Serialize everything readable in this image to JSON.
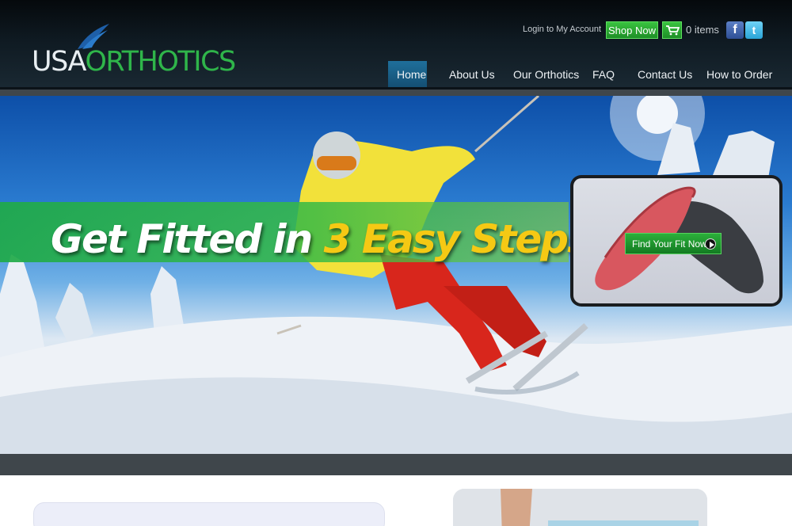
{
  "header": {
    "logo": {
      "part1": "USA",
      "part2": "ORTHOTICS"
    },
    "login_link": "Login to My Account",
    "shop_button": "Shop Now",
    "cart_count": "0 items",
    "social": {
      "facebook": "f",
      "twitter": "t"
    }
  },
  "nav": {
    "items": [
      {
        "label": "Home",
        "active": true
      },
      {
        "label": "About Us",
        "active": false
      },
      {
        "label": "Our Orthotics",
        "active": false
      },
      {
        "label": "FAQ",
        "active": false
      },
      {
        "label": "Contact Us",
        "active": false
      },
      {
        "label": "How to Order",
        "active": false
      }
    ]
  },
  "hero": {
    "headline_part1": "Get Fitted in ",
    "headline_part2": "3 Easy Steps",
    "cta_button": "Find Your Fit Now"
  },
  "icons": {
    "cart": "cart-icon",
    "play": "play-icon",
    "wing": "wing-icon"
  },
  "colors": {
    "brand_green": "#2fb54a",
    "headline_yellow": "#f5c914",
    "nav_active": "#1f6f9b"
  }
}
